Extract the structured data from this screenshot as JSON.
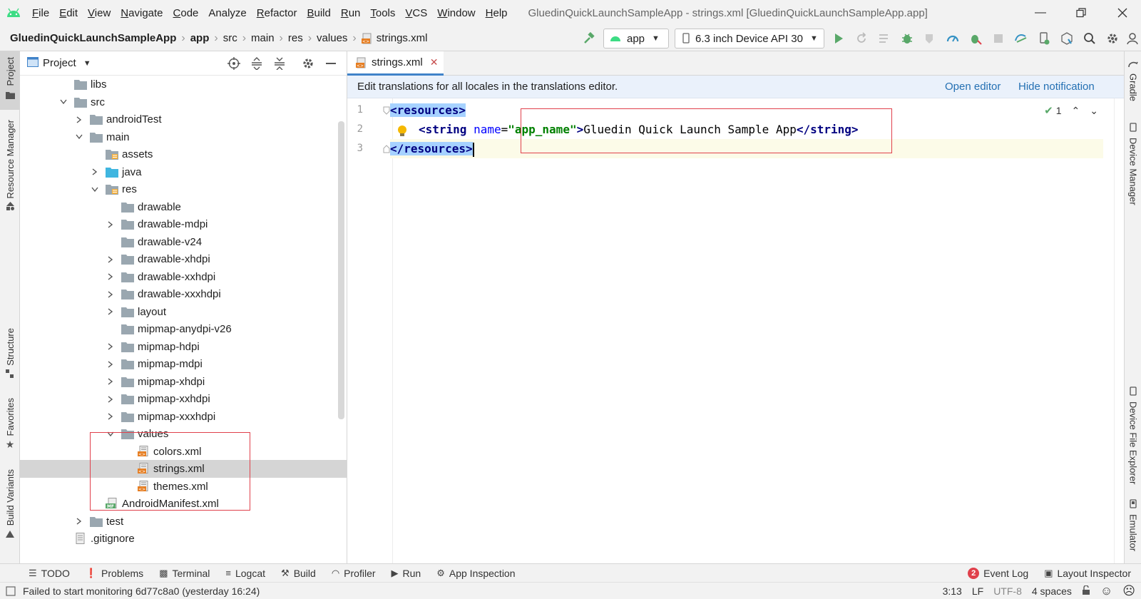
{
  "menu": {
    "items": [
      {
        "label": "File",
        "u": "F",
        "rest": "ile"
      },
      {
        "label": "Edit",
        "u": "E",
        "rest": "dit"
      },
      {
        "label": "View",
        "u": "V",
        "rest": "iew"
      },
      {
        "label": "Navigate",
        "u": "N",
        "rest": "avigate"
      },
      {
        "label": "Code",
        "u": "C",
        "rest": "ode"
      },
      {
        "label": "Analyze",
        "u": "",
        "rest": "Analyze"
      },
      {
        "label": "Refactor",
        "u": "R",
        "rest": "efactor"
      },
      {
        "label": "Build",
        "u": "B",
        "rest": "uild"
      },
      {
        "label": "Run",
        "u": "R",
        "rest": "un"
      },
      {
        "label": "Tools",
        "u": "T",
        "rest": "ools"
      },
      {
        "label": "VCS",
        "u": "V",
        "rest": "CS"
      },
      {
        "label": "Window",
        "u": "W",
        "rest": "indow"
      },
      {
        "label": "Help",
        "u": "H",
        "rest": "elp"
      }
    ],
    "window_title": "GluedinQuickLaunchSampleApp - strings.xml [GluedinQuickLaunchSampleApp.app]"
  },
  "breadcrumb": [
    "GluedinQuickLaunchSampleApp",
    "app",
    "src",
    "main",
    "res",
    "values",
    "strings.xml"
  ],
  "toolbar": {
    "run_config": "app",
    "device": "6.3 inch Device API 30"
  },
  "left_strip": {
    "project": "Project",
    "resource_manager": "Resource Manager",
    "structure": "Structure",
    "favorites": "Favorites",
    "build_variants": "Build Variants"
  },
  "right_strip": {
    "gradle": "Gradle",
    "device_manager": "Device Manager",
    "device_file_explorer": "Device File Explorer",
    "emulator": "Emulator"
  },
  "project_panel": {
    "title": "Project",
    "tree": [
      {
        "name": "libs",
        "chev": "",
        "type": "folder"
      },
      {
        "name": "src",
        "chev": "down",
        "type": "folder"
      },
      {
        "name": "androidTest",
        "chev": "right",
        "type": "folder"
      },
      {
        "name": "main",
        "chev": "down",
        "type": "folder"
      },
      {
        "name": "assets",
        "chev": "",
        "type": "res-folder"
      },
      {
        "name": "java",
        "chev": "right",
        "type": "blue-folder"
      },
      {
        "name": "res",
        "chev": "down",
        "type": "res-folder"
      },
      {
        "name": "drawable",
        "chev": "",
        "type": "folder"
      },
      {
        "name": "drawable-mdpi",
        "chev": "right",
        "type": "folder"
      },
      {
        "name": "drawable-v24",
        "chev": "",
        "type": "folder"
      },
      {
        "name": "drawable-xhdpi",
        "chev": "right",
        "type": "folder"
      },
      {
        "name": "drawable-xxhdpi",
        "chev": "right",
        "type": "folder"
      },
      {
        "name": "drawable-xxxhdpi",
        "chev": "right",
        "type": "folder"
      },
      {
        "name": "layout",
        "chev": "right",
        "type": "folder"
      },
      {
        "name": "mipmap-anydpi-v26",
        "chev": "",
        "type": "folder"
      },
      {
        "name": "mipmap-hdpi",
        "chev": "right",
        "type": "folder"
      },
      {
        "name": "mipmap-mdpi",
        "chev": "right",
        "type": "folder"
      },
      {
        "name": "mipmap-xhdpi",
        "chev": "right",
        "type": "folder"
      },
      {
        "name": "mipmap-xxhdpi",
        "chev": "right",
        "type": "folder"
      },
      {
        "name": "mipmap-xxxhdpi",
        "chev": "right",
        "type": "folder"
      },
      {
        "name": "values",
        "chev": "down",
        "type": "folder"
      },
      {
        "name": "colors.xml",
        "chev": "",
        "type": "xml"
      },
      {
        "name": "strings.xml",
        "chev": "",
        "type": "xml",
        "selected": true
      },
      {
        "name": "themes.xml",
        "chev": "",
        "type": "xml"
      },
      {
        "name": "AndroidManifest.xml",
        "chev": "",
        "type": "manifest"
      },
      {
        "name": "test",
        "chev": "right",
        "type": "folder"
      },
      {
        "name": ".gitignore",
        "chev": "",
        "type": "file"
      }
    ],
    "manifest_badge": "MF"
  },
  "editor": {
    "tab": "strings.xml",
    "notification": "Edit translations for all locales in the translations editor.",
    "open_editor": "Open editor",
    "hide_notification": "Hide notification",
    "line_numbers": [
      "1",
      "2",
      "3"
    ],
    "code": {
      "l1_tag": "<resources>",
      "l2_open": "<string",
      "l2_attr": "name",
      "l2_eq": "=",
      "l2_val": "\"app_name\"",
      "l2_gt": ">",
      "l2_text": "Gluedin Quick Launch Sample App",
      "l2_close": "</string>",
      "l3_tag": "</resources>"
    },
    "inspection_count": "1"
  },
  "bottom_tools": {
    "todo": "TODO",
    "problems": "Problems",
    "terminal": "Terminal",
    "logcat": "Logcat",
    "build": "Build",
    "profiler": "Profiler",
    "run": "Run",
    "app_inspection": "App Inspection",
    "event_log_count": "2",
    "event_log": "Event Log",
    "layout_inspector": "Layout Inspector"
  },
  "status": {
    "message": "Failed to start monitoring 6d77c8a0 (yesterday 16:24)",
    "position": "3:13",
    "line_sep": "LF",
    "encoding": "UTF-8",
    "indent": "4 spaces"
  },
  "colors": {
    "accent": "#4083c9",
    "highlight_box": "#e0404b",
    "android_green": "#3ddc84",
    "link": "#2470b3"
  }
}
